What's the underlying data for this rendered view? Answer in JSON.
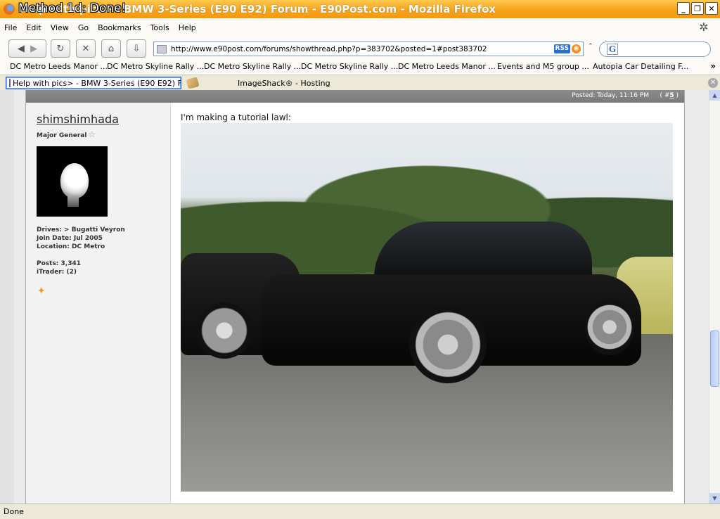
{
  "window": {
    "title": "Help with pics> - BMW 3-Series (E90 E92) Forum - E90Post.com - Mozilla Firefox",
    "overlay_caption": "Method 1d: Done!",
    "minimize": "_",
    "restore": "❐",
    "close": "✕"
  },
  "menu": [
    "File",
    "Edit",
    "View",
    "Go",
    "Bookmarks",
    "Tools",
    "Help"
  ],
  "toolbar": {
    "url": "http://www.e90post.com/forums/showthread.php?p=383702&posted=1#post383702",
    "rss_label": "RSS",
    "search_placeholder": "",
    "search_engine_letter": "G"
  },
  "bookmarks": [
    "DC Metro Leeds Manor ...",
    "DC Metro Skyline Rally ...",
    "DC Metro Skyline Rally ...",
    "DC Metro Skyline Rally ...",
    "DC Metro Leeds Manor ...",
    "Events and M5 group ...",
    "Autopia Car Detailing F..."
  ],
  "bookmarks_more": "»",
  "tabs": [
    {
      "label": "Help with pics> - BMW 3-Series (E90 E92) F...",
      "active": true
    },
    {
      "label": "ImageShack® - Hosting",
      "active": false
    }
  ],
  "post": {
    "posted": "Posted: Today, 11:16 PM",
    "number_prefix": "#",
    "number": "5",
    "user": {
      "name": "shimshimhada",
      "title": "Major General",
      "drives": "Drives: > Bugatti Veyron",
      "join_date": "Join Date: Jul 2005",
      "location": "Location: DC Metro",
      "posts": "Posts: 3,341",
      "itrader_label": "iTrader:",
      "itrader_count": "(2)"
    },
    "message": "I'm making a tutorial lawl:"
  },
  "status": "Done",
  "colors": {
    "titlebar": "#f7a21b",
    "post_header": "#808080",
    "user_panel": "#f2f2f2"
  }
}
